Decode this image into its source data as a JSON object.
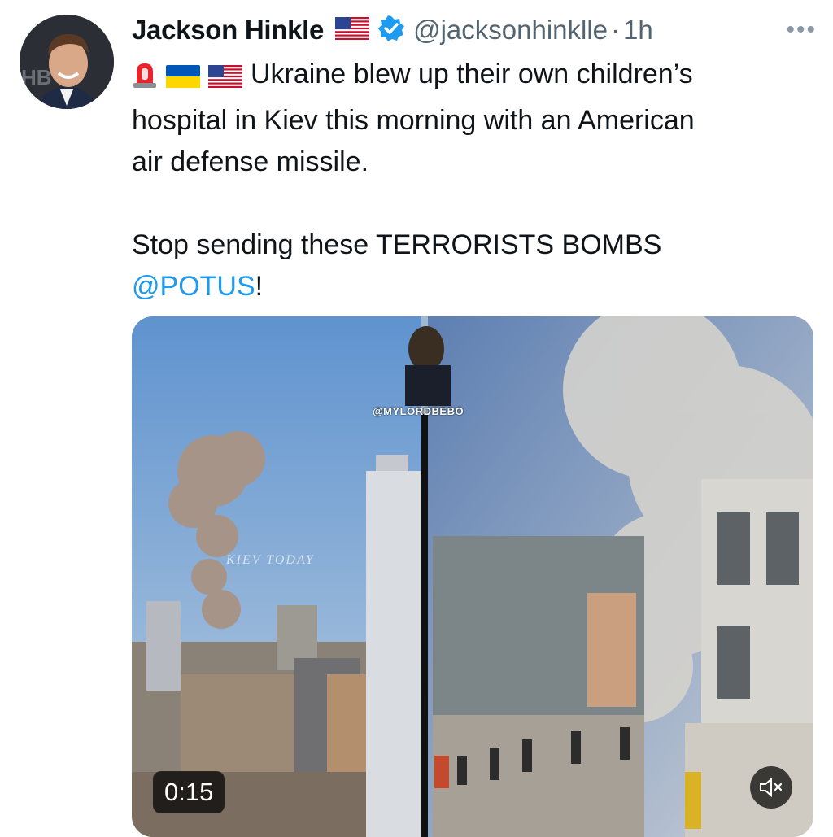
{
  "tweet": {
    "author_name": "Jackson Hinkle",
    "handle": "@jacksonhinklle",
    "separator": "·",
    "time": "1h",
    "more_label": "•••",
    "text_line1": "Ukraine blew up their own children’s",
    "text_line2": "hospital in Kiev this morning with an American",
    "text_line3": "air defense missile.",
    "text_line4": "Stop sending these TERRORISTS BOMBS",
    "mention": "@POTUS",
    "mention_suffix": "!",
    "leading_emojis": [
      "siren-icon",
      "ukraine-flag-icon",
      "us-flag-icon"
    ]
  },
  "media": {
    "duration": "0:15",
    "watermark": "@MYLORDBEBO",
    "left_watermark": "KIEV TODAY",
    "mute_icon": "speaker-muted-icon"
  },
  "colors": {
    "text": "#0f1419",
    "secondary": "#536471",
    "link": "#1d9bf0",
    "verified": "#1d9bf0"
  }
}
